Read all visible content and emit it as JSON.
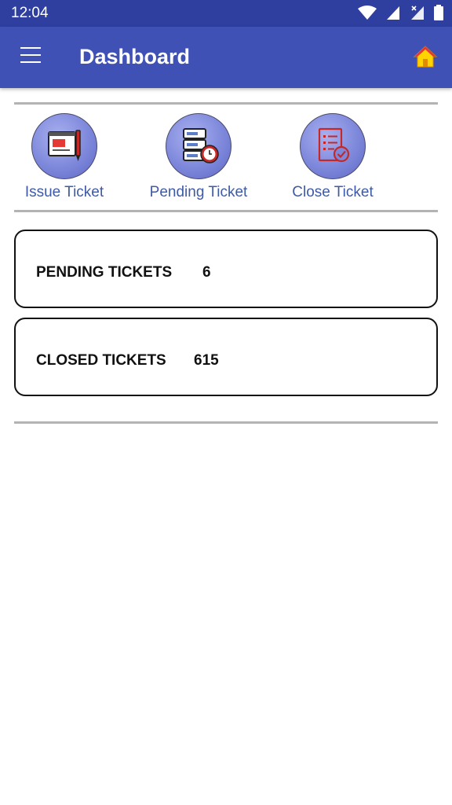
{
  "status_bar": {
    "time": "12:04"
  },
  "app_bar": {
    "title": "Dashboard",
    "menu_icon": "hamburger-menu-icon",
    "home_icon": "home-icon"
  },
  "colors": {
    "app_bar": "#3f51b5",
    "status_bar": "#2f3fa0",
    "label_blue": "#3f5aa6"
  },
  "quick_actions": [
    {
      "label": "Issue Ticket",
      "icon": "issue-ticket-icon"
    },
    {
      "label": "Pending Ticket",
      "icon": "pending-ticket-icon"
    },
    {
      "label": "Close Ticket",
      "icon": "close-ticket-icon"
    }
  ],
  "stats": [
    {
      "label": "PENDING TICKETS",
      "value": "6"
    },
    {
      "label": "CLOSED TICKETS",
      "value": "615"
    }
  ]
}
